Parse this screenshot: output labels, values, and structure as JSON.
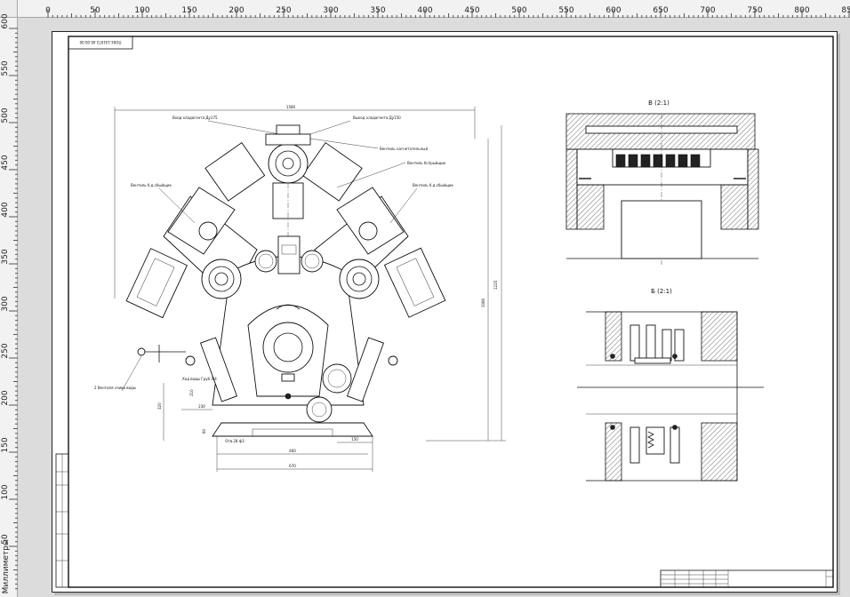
{
  "rulers": {
    "units_label": "Миллиметры",
    "top_ticks": [
      "0",
      "50",
      "100",
      "150",
      "200",
      "250",
      "300",
      "350",
      "400",
      "450",
      "500",
      "550",
      "600",
      "650",
      "700",
      "750",
      "800",
      "850"
    ],
    "left_ticks": [
      "600",
      "550",
      "500",
      "450",
      "400",
      "350",
      "300",
      "250",
      "200",
      "150",
      "100",
      "50"
    ]
  },
  "drawing": {
    "designation_stamp": "ПО04.141072.06.00.00",
    "labels": {
      "inlet": "Вход хладагента Ду175",
      "outlet": "Выход хладагента Ду150",
      "valve_safety": "Вентиль нагнетательный",
      "bypass": "Вентиль бспрыйщик",
      "valve_left": "Вентиль б.д.сбыйщик",
      "valve_right": "Вентиль б.д.сбыйщик",
      "drain_valve": "2 Вентиля\nслива воды",
      "water": "Ход воды\nГруб 3/4"
    },
    "dimensions": {
      "overall_width": "1580",
      "height_outer": "1225",
      "height_inner": "1080",
      "foot_left": "Отв.28 ф3",
      "d_460": "460",
      "d_670": "670",
      "d_150": "150",
      "d_230": "230",
      "d_320": "320",
      "d_210": "210",
      "d_60": "60"
    },
    "views": {
      "view_b": "В (2:1)",
      "view_v": "Б (2:1)"
    }
  }
}
